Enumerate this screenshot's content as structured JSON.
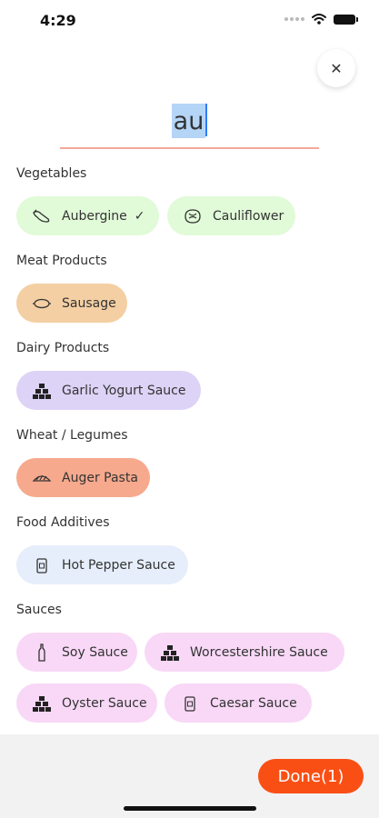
{
  "status": {
    "time": "4:29"
  },
  "search": {
    "value": "au"
  },
  "sections": {
    "vegetables": {
      "title": "Vegetables",
      "chips": [
        {
          "label": "Aubergine",
          "icon": "aubergine-icon",
          "selected": true
        },
        {
          "label": "Cauliflower",
          "icon": "cauliflower-icon",
          "selected": false
        }
      ]
    },
    "meat": {
      "title": "Meat Products",
      "chips": [
        {
          "label": "Sausage",
          "icon": "sausage-icon",
          "selected": false
        }
      ]
    },
    "dairy": {
      "title": "Dairy Products",
      "chips": [
        {
          "label": "Garlic Yogurt Sauce",
          "icon": "boxes-icon",
          "selected": false
        }
      ]
    },
    "wheat": {
      "title": "Wheat / Legumes",
      "chips": [
        {
          "label": "Auger Pasta",
          "icon": "pasta-icon",
          "selected": false
        }
      ]
    },
    "additives": {
      "title": "Food Additives",
      "chips": [
        {
          "label": "Hot Pepper Sauce",
          "icon": "jar-icon",
          "selected": false
        }
      ]
    },
    "sauces": {
      "title": "Sauces",
      "chips": [
        {
          "label": "Soy Sauce",
          "icon": "bottle-icon",
          "selected": false
        },
        {
          "label": "Worcestershire Sauce",
          "icon": "boxes-icon",
          "selected": false
        },
        {
          "label": "Oyster Sauce",
          "icon": "boxes-icon",
          "selected": false
        },
        {
          "label": "Caesar Sauce",
          "icon": "jar-icon",
          "selected": false
        }
      ]
    }
  },
  "colors": {
    "vegetables": "#e1fad8",
    "meat": "#f4cfa3",
    "dairy": "#ddd3f6",
    "wheat": "#f6a98d",
    "additives": "#e6eefb",
    "sauces": "#f8d8f6",
    "accent": "#fa4f14",
    "underline": "#f4a89a"
  },
  "done_button": {
    "label": "Done(1)"
  }
}
